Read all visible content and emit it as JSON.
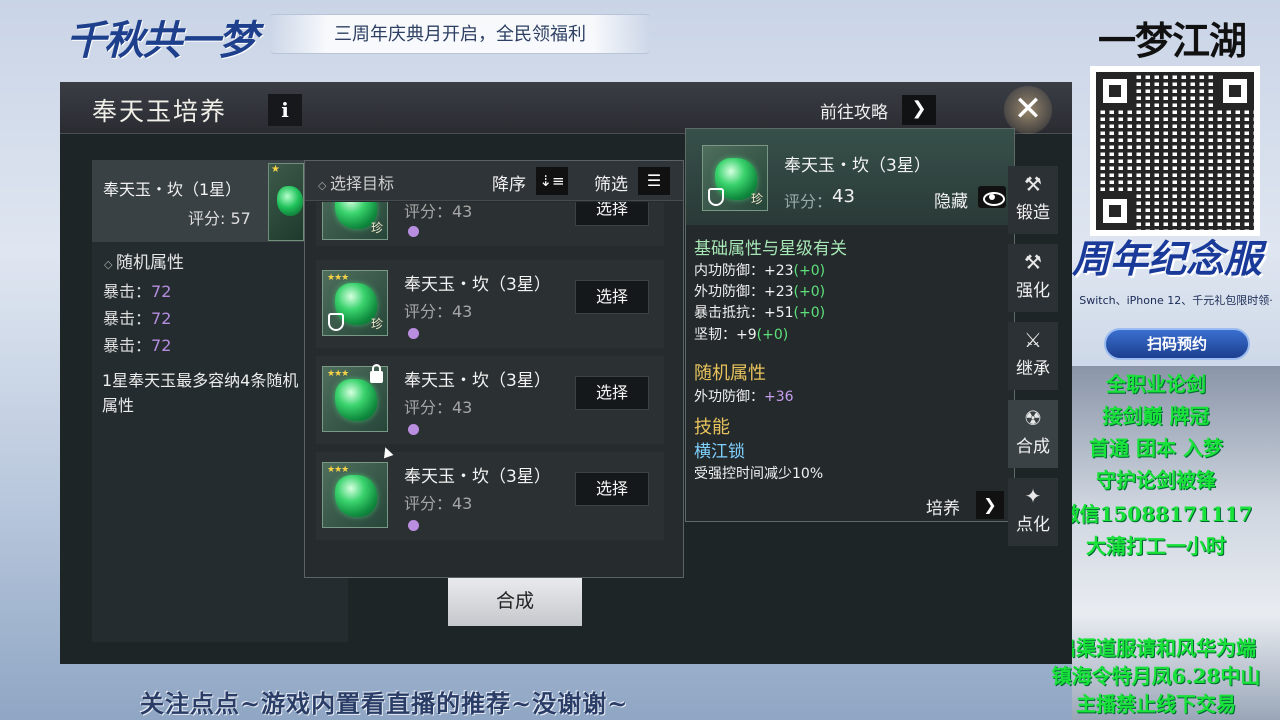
{
  "overlay": {
    "logo_left": "千秋共一梦",
    "banner": "三周年庆典月开启，全民领福利",
    "logo_right": "一梦江湖",
    "anniversary": "周年纪念服",
    "promo_small": "Switch、iPhone 12、千元礼包限时领·",
    "scan_button": "扫码预约",
    "green_lines": [
      "全职业论剑",
      "接剑巅 牌冠",
      "首通 团本 入梦",
      "守护论剑被锋",
      "微信15088171117",
      "大蒲打工一小时"
    ],
    "green_bottom": [
      "出渠道服请和风华为端",
      "镇海令特月凤6.28中山",
      "主播禁止线下交易"
    ],
    "bottom_text": "关注点点~游戏内置看直播的推荐~没谢谢~"
  },
  "window": {
    "title": "奉天玉培养",
    "info_icon": "i",
    "guide_label": "前往攻略",
    "guide_icon": "chevron-right-icon",
    "close_icon": "close-icon"
  },
  "left": {
    "name": "奉天玉・坎（1星）",
    "score": "评分: 57",
    "section": "随机属性",
    "attrs": [
      {
        "label": "暴击：",
        "value": "72"
      },
      {
        "label": "暴击：",
        "value": "72"
      },
      {
        "label": "暴击：",
        "value": "72"
      }
    ],
    "note": "1星奉天玉最多容纳4条随机属性"
  },
  "selector": {
    "target_label": "选择目标",
    "order_label": "降序",
    "filter_label": "筛选",
    "partial_row": {
      "score_label": "评分：43",
      "button": "选择"
    },
    "rows": [
      {
        "name": "奉天玉・坎（3星）",
        "score": "评分：43",
        "button": "选择",
        "rare": "珍",
        "locked": false,
        "stars": "★★★"
      },
      {
        "name": "奉天玉・坎（3星）",
        "score": "评分：43",
        "button": "选择",
        "rare": "",
        "locked": true,
        "stars": "★★★"
      },
      {
        "name": "奉天玉・坎（3星）",
        "score": "评分：43",
        "button": "选择",
        "rare": "",
        "locked": false,
        "stars": "★★★"
      }
    ]
  },
  "merge_button": "合成",
  "detail": {
    "name": "奉天玉・坎（3星）",
    "rare": "珍",
    "score_label": "评分：",
    "score": "43",
    "hide_label": "隐藏",
    "base_section": "基础属性与星级有关",
    "base_attrs": [
      {
        "label": "内功防御：+23",
        "bonus": "(+0)"
      },
      {
        "label": "外功防御：+23",
        "bonus": "(+0)"
      },
      {
        "label": "暴击抵抗：+51",
        "bonus": "(+0)"
      },
      {
        "label": "坚韧：+9",
        "bonus": "(+0)"
      }
    ],
    "random_section": "随机属性",
    "random_attr": {
      "label": "外功防御：",
      "value": "+36"
    },
    "skill_section": "技能",
    "skill_name": "横江锁",
    "skill_desc": "受强控时间减少10%",
    "train_label": "培养"
  },
  "tabs": [
    {
      "label": "锻造",
      "icon": "anvil-icon"
    },
    {
      "label": "强化",
      "icon": "hammer-icon"
    },
    {
      "label": "继承",
      "icon": "inherit-icon"
    },
    {
      "label": "合成",
      "icon": "merge-icon"
    },
    {
      "label": "点化",
      "icon": "transmute-icon"
    }
  ]
}
